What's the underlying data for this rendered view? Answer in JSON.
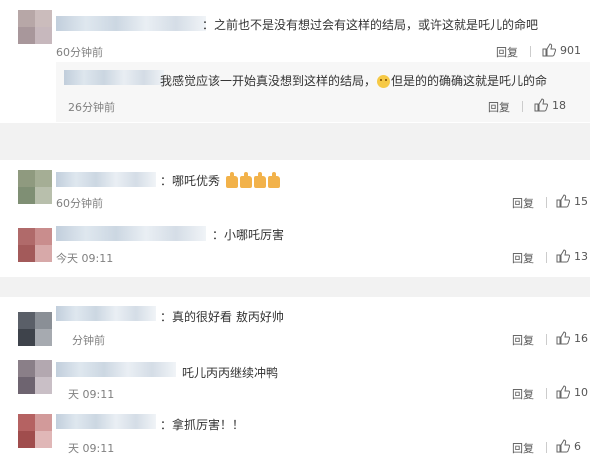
{
  "comments": [
    {
      "text": "：之前也不是没有想过会有这样的结局，或许这就是吒儿的命吧",
      "time": "60分钟前",
      "reply": "回复",
      "likes": "901"
    },
    {
      "text_before": "我感觉应该一开始真没想到这样的结局，",
      "text_after": "但是的的确确这就是吒儿的命",
      "time": "26分钟前",
      "reply": "回复",
      "likes": "18"
    },
    {
      "text": "：哪吒优秀",
      "time": "60分钟前",
      "reply": "回复",
      "likes": "15"
    },
    {
      "text": "：小哪吒厉害",
      "time": "今天 09:11",
      "reply": "回复",
      "likes": "13"
    },
    {
      "text": "：真的很好看 敖丙好帅",
      "time": "分钟前",
      "reply": "回复",
      "likes": "16"
    },
    {
      "text": "吒儿丙丙继续冲鸭",
      "time": "天 09:11",
      "reply": "回复",
      "likes": "10"
    },
    {
      "text": "：拿抓厉害！！",
      "time": "天 09:11",
      "reply": "回复",
      "likes": "6"
    }
  ],
  "icons": {
    "like": "thumbs-up-icon",
    "emoji": "smiley-emoji-icon",
    "thumbs": "thumbs-up-emoji-icon"
  },
  "colors": {
    "background": "#ffffff",
    "gap": "#f2f2f2",
    "sub_background": "#f7f7f7",
    "text": "#333333",
    "muted": "#808080"
  }
}
